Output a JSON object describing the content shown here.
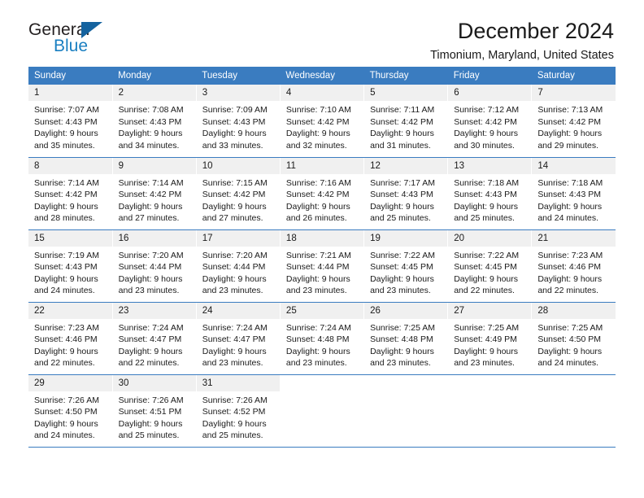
{
  "brand": {
    "name_top": "General",
    "name_bottom": "Blue",
    "triangle_color": "#15639f",
    "blue": "#1a7fc1"
  },
  "header": {
    "title": "December 2024",
    "subtitle": "Timonium, Maryland, United States"
  },
  "theme": {
    "header_blue": "#3a7cc0",
    "daynum_bg": "#f0f0f0",
    "text": "#1a1a1a"
  },
  "weekday_headers": [
    "Sunday",
    "Monday",
    "Tuesday",
    "Wednesday",
    "Thursday",
    "Friday",
    "Saturday"
  ],
  "weeks": [
    [
      {
        "day": "1",
        "sunrise": "Sunrise: 7:07 AM",
        "sunset": "Sunset: 4:43 PM",
        "daylight_line1": "Daylight: 9 hours",
        "daylight_line2": "and 35 minutes."
      },
      {
        "day": "2",
        "sunrise": "Sunrise: 7:08 AM",
        "sunset": "Sunset: 4:43 PM",
        "daylight_line1": "Daylight: 9 hours",
        "daylight_line2": "and 34 minutes."
      },
      {
        "day": "3",
        "sunrise": "Sunrise: 7:09 AM",
        "sunset": "Sunset: 4:43 PM",
        "daylight_line1": "Daylight: 9 hours",
        "daylight_line2": "and 33 minutes."
      },
      {
        "day": "4",
        "sunrise": "Sunrise: 7:10 AM",
        "sunset": "Sunset: 4:42 PM",
        "daylight_line1": "Daylight: 9 hours",
        "daylight_line2": "and 32 minutes."
      },
      {
        "day": "5",
        "sunrise": "Sunrise: 7:11 AM",
        "sunset": "Sunset: 4:42 PM",
        "daylight_line1": "Daylight: 9 hours",
        "daylight_line2": "and 31 minutes."
      },
      {
        "day": "6",
        "sunrise": "Sunrise: 7:12 AM",
        "sunset": "Sunset: 4:42 PM",
        "daylight_line1": "Daylight: 9 hours",
        "daylight_line2": "and 30 minutes."
      },
      {
        "day": "7",
        "sunrise": "Sunrise: 7:13 AM",
        "sunset": "Sunset: 4:42 PM",
        "daylight_line1": "Daylight: 9 hours",
        "daylight_line2": "and 29 minutes."
      }
    ],
    [
      {
        "day": "8",
        "sunrise": "Sunrise: 7:14 AM",
        "sunset": "Sunset: 4:42 PM",
        "daylight_line1": "Daylight: 9 hours",
        "daylight_line2": "and 28 minutes."
      },
      {
        "day": "9",
        "sunrise": "Sunrise: 7:14 AM",
        "sunset": "Sunset: 4:42 PM",
        "daylight_line1": "Daylight: 9 hours",
        "daylight_line2": "and 27 minutes."
      },
      {
        "day": "10",
        "sunrise": "Sunrise: 7:15 AM",
        "sunset": "Sunset: 4:42 PM",
        "daylight_line1": "Daylight: 9 hours",
        "daylight_line2": "and 27 minutes."
      },
      {
        "day": "11",
        "sunrise": "Sunrise: 7:16 AM",
        "sunset": "Sunset: 4:42 PM",
        "daylight_line1": "Daylight: 9 hours",
        "daylight_line2": "and 26 minutes."
      },
      {
        "day": "12",
        "sunrise": "Sunrise: 7:17 AM",
        "sunset": "Sunset: 4:43 PM",
        "daylight_line1": "Daylight: 9 hours",
        "daylight_line2": "and 25 minutes."
      },
      {
        "day": "13",
        "sunrise": "Sunrise: 7:18 AM",
        "sunset": "Sunset: 4:43 PM",
        "daylight_line1": "Daylight: 9 hours",
        "daylight_line2": "and 25 minutes."
      },
      {
        "day": "14",
        "sunrise": "Sunrise: 7:18 AM",
        "sunset": "Sunset: 4:43 PM",
        "daylight_line1": "Daylight: 9 hours",
        "daylight_line2": "and 24 minutes."
      }
    ],
    [
      {
        "day": "15",
        "sunrise": "Sunrise: 7:19 AM",
        "sunset": "Sunset: 4:43 PM",
        "daylight_line1": "Daylight: 9 hours",
        "daylight_line2": "and 24 minutes."
      },
      {
        "day": "16",
        "sunrise": "Sunrise: 7:20 AM",
        "sunset": "Sunset: 4:44 PM",
        "daylight_line1": "Daylight: 9 hours",
        "daylight_line2": "and 23 minutes."
      },
      {
        "day": "17",
        "sunrise": "Sunrise: 7:20 AM",
        "sunset": "Sunset: 4:44 PM",
        "daylight_line1": "Daylight: 9 hours",
        "daylight_line2": "and 23 minutes."
      },
      {
        "day": "18",
        "sunrise": "Sunrise: 7:21 AM",
        "sunset": "Sunset: 4:44 PM",
        "daylight_line1": "Daylight: 9 hours",
        "daylight_line2": "and 23 minutes."
      },
      {
        "day": "19",
        "sunrise": "Sunrise: 7:22 AM",
        "sunset": "Sunset: 4:45 PM",
        "daylight_line1": "Daylight: 9 hours",
        "daylight_line2": "and 23 minutes."
      },
      {
        "day": "20",
        "sunrise": "Sunrise: 7:22 AM",
        "sunset": "Sunset: 4:45 PM",
        "daylight_line1": "Daylight: 9 hours",
        "daylight_line2": "and 22 minutes."
      },
      {
        "day": "21",
        "sunrise": "Sunrise: 7:23 AM",
        "sunset": "Sunset: 4:46 PM",
        "daylight_line1": "Daylight: 9 hours",
        "daylight_line2": "and 22 minutes."
      }
    ],
    [
      {
        "day": "22",
        "sunrise": "Sunrise: 7:23 AM",
        "sunset": "Sunset: 4:46 PM",
        "daylight_line1": "Daylight: 9 hours",
        "daylight_line2": "and 22 minutes."
      },
      {
        "day": "23",
        "sunrise": "Sunrise: 7:24 AM",
        "sunset": "Sunset: 4:47 PM",
        "daylight_line1": "Daylight: 9 hours",
        "daylight_line2": "and 22 minutes."
      },
      {
        "day": "24",
        "sunrise": "Sunrise: 7:24 AM",
        "sunset": "Sunset: 4:47 PM",
        "daylight_line1": "Daylight: 9 hours",
        "daylight_line2": "and 23 minutes."
      },
      {
        "day": "25",
        "sunrise": "Sunrise: 7:24 AM",
        "sunset": "Sunset: 4:48 PM",
        "daylight_line1": "Daylight: 9 hours",
        "daylight_line2": "and 23 minutes."
      },
      {
        "day": "26",
        "sunrise": "Sunrise: 7:25 AM",
        "sunset": "Sunset: 4:48 PM",
        "daylight_line1": "Daylight: 9 hours",
        "daylight_line2": "and 23 minutes."
      },
      {
        "day": "27",
        "sunrise": "Sunrise: 7:25 AM",
        "sunset": "Sunset: 4:49 PM",
        "daylight_line1": "Daylight: 9 hours",
        "daylight_line2": "and 23 minutes."
      },
      {
        "day": "28",
        "sunrise": "Sunrise: 7:25 AM",
        "sunset": "Sunset: 4:50 PM",
        "daylight_line1": "Daylight: 9 hours",
        "daylight_line2": "and 24 minutes."
      }
    ],
    [
      {
        "day": "29",
        "sunrise": "Sunrise: 7:26 AM",
        "sunset": "Sunset: 4:50 PM",
        "daylight_line1": "Daylight: 9 hours",
        "daylight_line2": "and 24 minutes."
      },
      {
        "day": "30",
        "sunrise": "Sunrise: 7:26 AM",
        "sunset": "Sunset: 4:51 PM",
        "daylight_line1": "Daylight: 9 hours",
        "daylight_line2": "and 25 minutes."
      },
      {
        "day": "31",
        "sunrise": "Sunrise: 7:26 AM",
        "sunset": "Sunset: 4:52 PM",
        "daylight_line1": "Daylight: 9 hours",
        "daylight_line2": "and 25 minutes."
      },
      {
        "day": "",
        "sunrise": "",
        "sunset": "",
        "daylight_line1": "",
        "daylight_line2": ""
      },
      {
        "day": "",
        "sunrise": "",
        "sunset": "",
        "daylight_line1": "",
        "daylight_line2": ""
      },
      {
        "day": "",
        "sunrise": "",
        "sunset": "",
        "daylight_line1": "",
        "daylight_line2": ""
      },
      {
        "day": "",
        "sunrise": "",
        "sunset": "",
        "daylight_line1": "",
        "daylight_line2": ""
      }
    ]
  ]
}
